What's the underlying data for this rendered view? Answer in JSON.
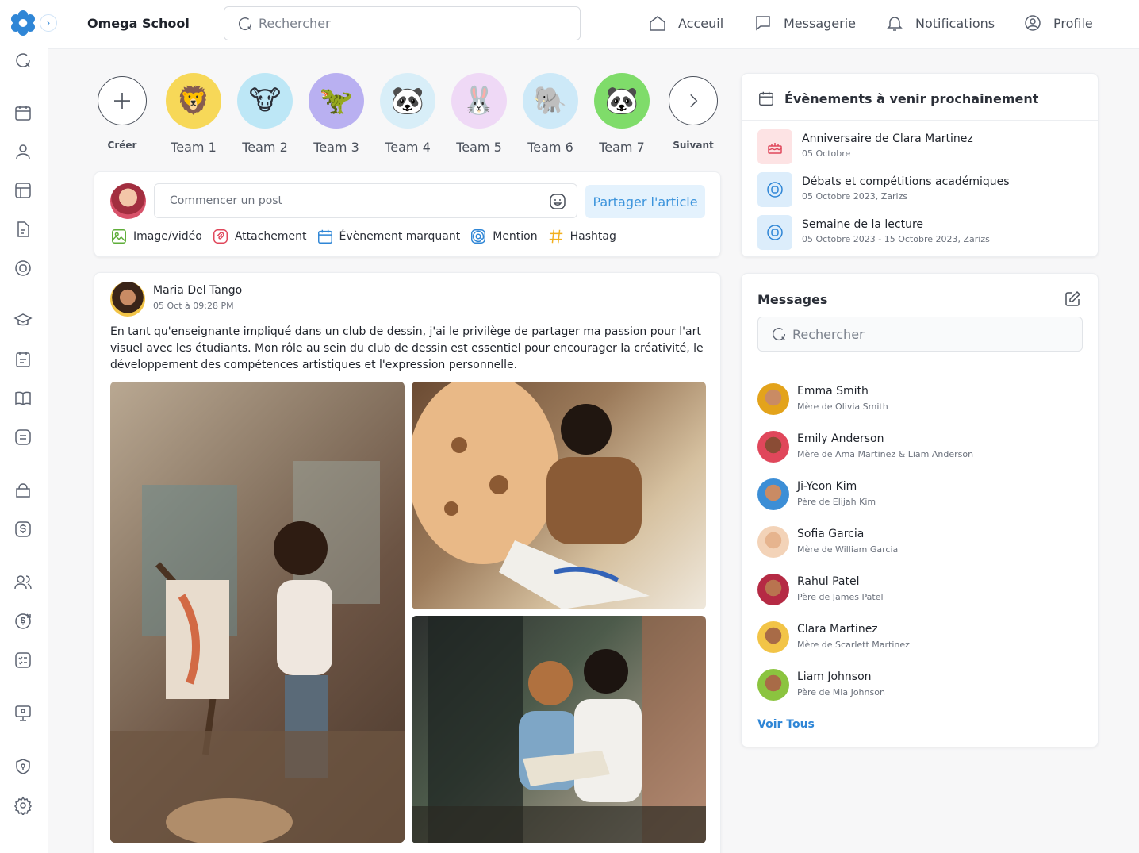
{
  "brand": "Omega School",
  "search": {
    "placeholder": "Rechercher"
  },
  "nav": [
    {
      "label": "Acceuil",
      "icon": "home-icon"
    },
    {
      "label": "Messagerie",
      "icon": "chat-icon"
    },
    {
      "label": "Notifications",
      "icon": "bell-icon"
    },
    {
      "label": "Profile",
      "icon": "user-icon"
    }
  ],
  "stories": {
    "create": "Créer",
    "next": "Suivant",
    "teams": [
      "Team 1",
      "Team 2",
      "Team 3",
      "Team 4",
      "Team 5",
      "Team 6",
      "Team 7"
    ]
  },
  "composer": {
    "placeholder": "Commencer un post",
    "share": "Partager l'article",
    "actions": [
      "Image/vidéo",
      "Attachement",
      "Évènement marquant",
      "Mention",
      "Hashtag"
    ]
  },
  "post": {
    "author": "Maria Del Tango",
    "date": "05 Oct à 09:28 PM",
    "text": "En tant qu'enseignante impliqué dans un club de dessin, j'ai le privilège de partager ma passion pour l'art visuel avec les étudiants. Mon rôle au sein du club de dessin est essentiel pour encourager la créativité, le développement des compétences artistiques et l'expression personnelle."
  },
  "events": {
    "title": "Évènements à venir prochainement",
    "items": [
      {
        "title": "Anniversaire de Clara Martinez",
        "sub": "05 Octobre"
      },
      {
        "title": "Débats et compétitions académiques",
        "sub": "05 Octobre 2023, Zarizs"
      },
      {
        "title": "Semaine de la lecture",
        "sub": "05 Octobre 2023 - 15 Octobre 2023, Zarizs"
      }
    ]
  },
  "messages": {
    "title": "Messages",
    "search_placeholder": "Rechercher",
    "contacts": [
      {
        "name": "Emma Smith",
        "role": "Mère de Olivia Smith"
      },
      {
        "name": "Emily Anderson",
        "role": "Mère de Ama Martinez & Liam Anderson"
      },
      {
        "name": "Ji-Yeon Kim",
        "role": "Père de Elijah Kim"
      },
      {
        "name": "Sofia Garcia",
        "role": "Mère de William Garcia"
      },
      {
        "name": "Rahul Patel",
        "role": "Père de James Patel"
      },
      {
        "name": "Clara Martinez",
        "role": "Mère de Scarlett Martinez"
      },
      {
        "name": "Liam Johnson",
        "role": "Père de Mia Johnson"
      }
    ],
    "see_all": "Voir Tous"
  }
}
